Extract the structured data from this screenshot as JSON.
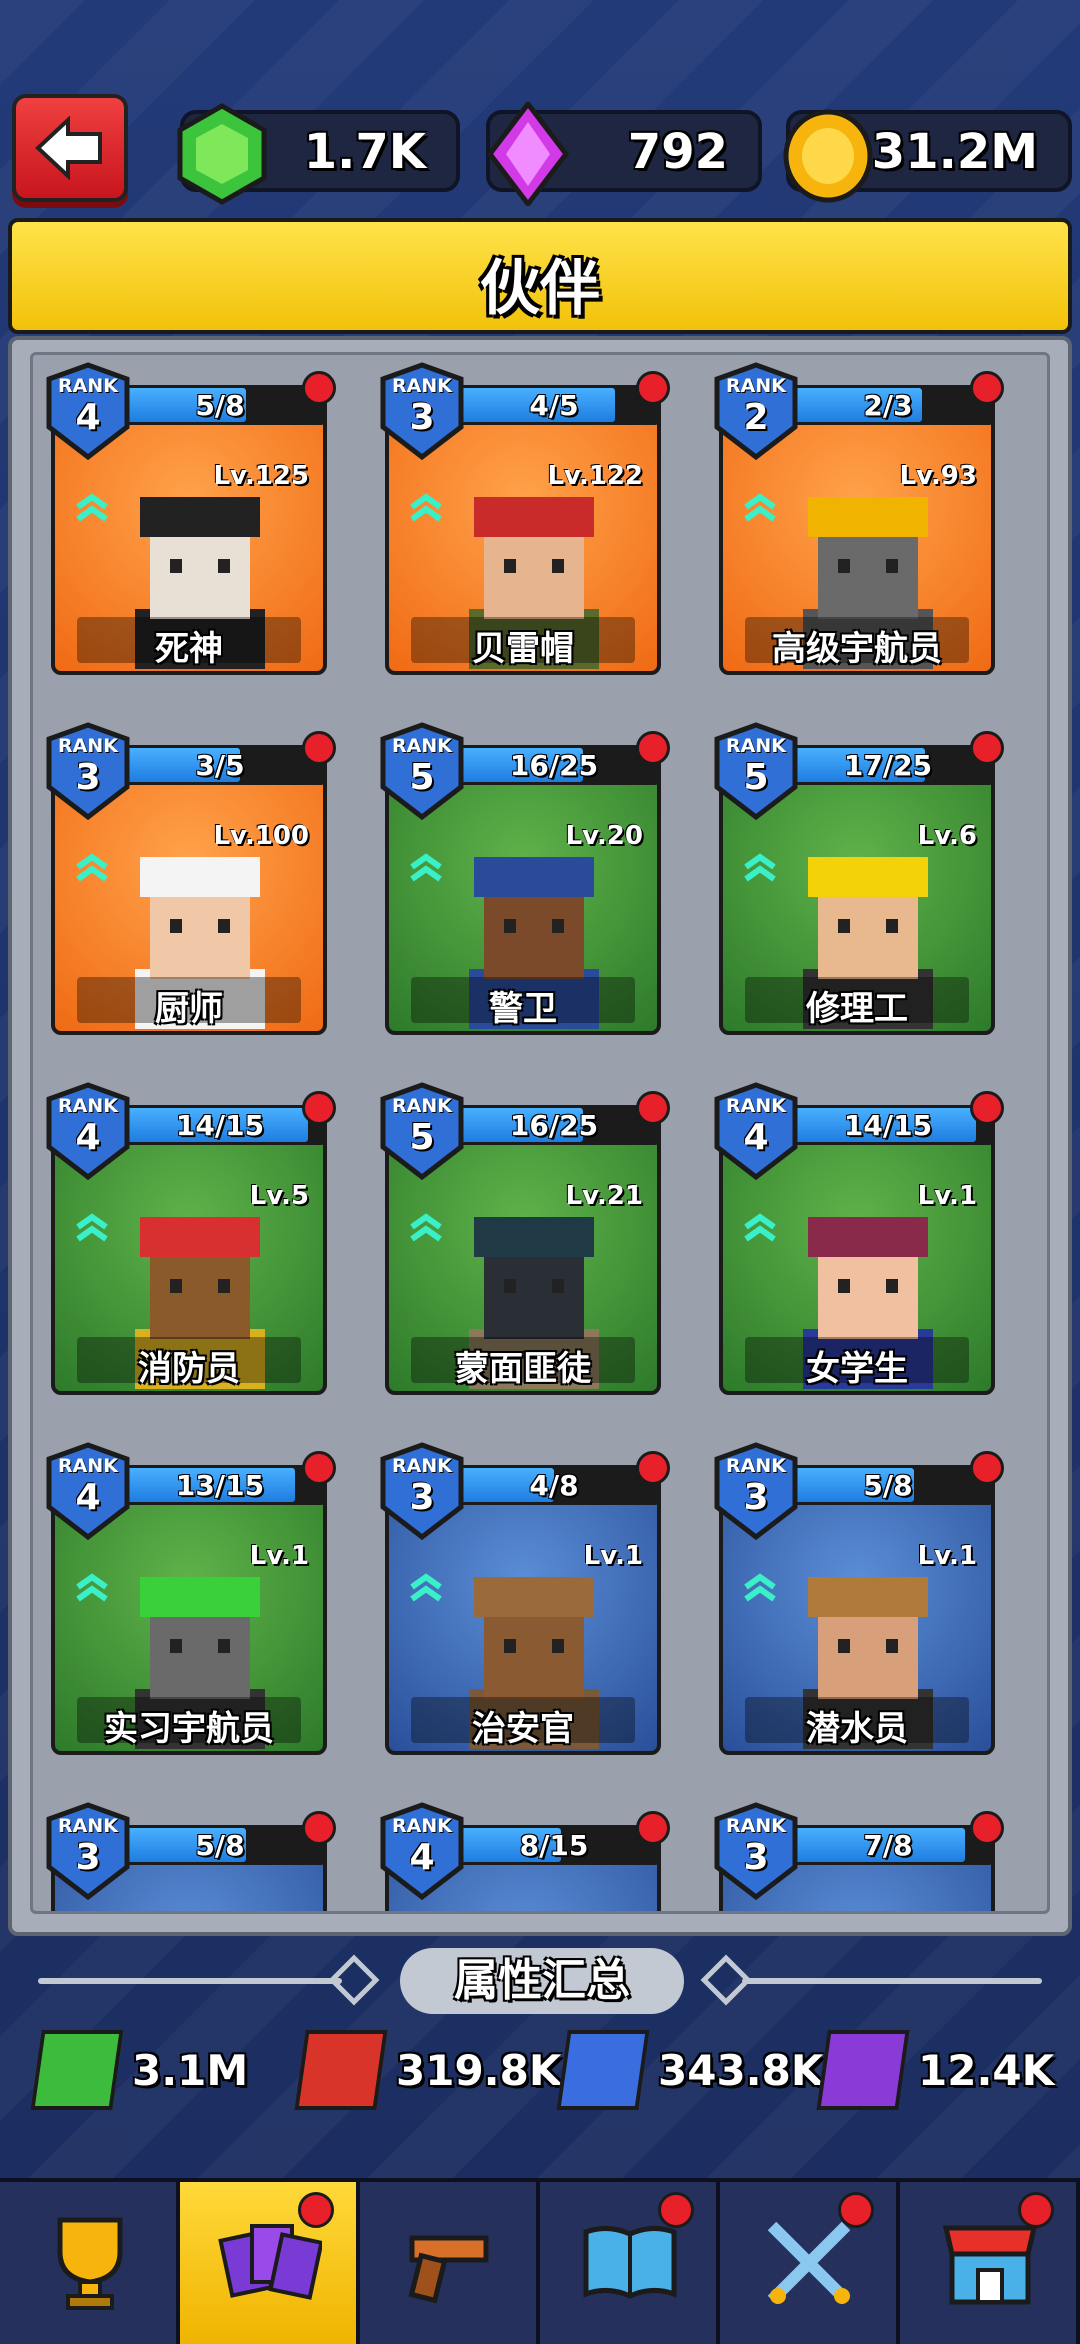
{
  "header": {
    "currencies": [
      {
        "icon": "green-gem-icon",
        "value": "1.7K"
      },
      {
        "icon": "purple-crystal-icon",
        "value": "792"
      },
      {
        "icon": "gold-coin-icon",
        "value": "31.2M"
      }
    ],
    "title": "伙伴"
  },
  "cards": [
    {
      "rank_label": "RANK",
      "rank": "4",
      "fragments": "5/8",
      "level": "Lv.125",
      "name": "死神",
      "bg": "orange",
      "fill": 0.625
    },
    {
      "rank_label": "RANK",
      "rank": "3",
      "fragments": "4/5",
      "level": "Lv.122",
      "name": "贝雷帽",
      "bg": "orange",
      "fill": 0.8
    },
    {
      "rank_label": "RANK",
      "rank": "2",
      "fragments": "2/3",
      "level": "Lv.93",
      "name": "高级宇航员",
      "bg": "orange",
      "fill": 0.667
    },
    {
      "rank_label": "RANK",
      "rank": "3",
      "fragments": "3/5",
      "level": "Lv.100",
      "name": "厨师",
      "bg": "orange",
      "fill": 0.6
    },
    {
      "rank_label": "RANK",
      "rank": "5",
      "fragments": "16/25",
      "level": "Lv.20",
      "name": "警卫",
      "bg": "green",
      "fill": 0.64
    },
    {
      "rank_label": "RANK",
      "rank": "5",
      "fragments": "17/25",
      "level": "Lv.6",
      "name": "修理工",
      "bg": "green",
      "fill": 0.68
    },
    {
      "rank_label": "RANK",
      "rank": "4",
      "fragments": "14/15",
      "level": "Lv.5",
      "name": "消防员",
      "bg": "green",
      "fill": 0.933
    },
    {
      "rank_label": "RANK",
      "rank": "5",
      "fragments": "16/25",
      "level": "Lv.21",
      "name": "蒙面匪徒",
      "bg": "green",
      "fill": 0.64
    },
    {
      "rank_label": "RANK",
      "rank": "4",
      "fragments": "14/15",
      "level": "Lv.1",
      "name": "女学生",
      "bg": "green",
      "fill": 0.933
    },
    {
      "rank_label": "RANK",
      "rank": "4",
      "fragments": "13/15",
      "level": "Lv.1",
      "name": "实习宇航员",
      "bg": "green",
      "fill": 0.867
    },
    {
      "rank_label": "RANK",
      "rank": "3",
      "fragments": "4/8",
      "level": "Lv.1",
      "name": "治安官",
      "bg": "blue",
      "fill": 0.5
    },
    {
      "rank_label": "RANK",
      "rank": "3",
      "fragments": "5/8",
      "level": "Lv.1",
      "name": "潜水员",
      "bg": "blue",
      "fill": 0.625
    },
    {
      "rank_label": "RANK",
      "rank": "3",
      "fragments": "5/8",
      "level": "",
      "name": "",
      "bg": "blue",
      "fill": 0.625
    },
    {
      "rank_label": "RANK",
      "rank": "4",
      "fragments": "8/15",
      "level": "",
      "name": "",
      "bg": "blue",
      "fill": 0.533
    },
    {
      "rank_label": "RANK",
      "rank": "3",
      "fragments": "7/8",
      "level": "",
      "name": "",
      "bg": "blue",
      "fill": 0.875
    }
  ],
  "summary": {
    "title": "属性汇总",
    "stats": [
      {
        "icon": "tower-icon",
        "value": "3.1M",
        "color": "#3dbb3d"
      },
      {
        "icon": "fist-icon",
        "value": "319.8K",
        "color": "#d9342a"
      },
      {
        "icon": "auto-gun-icon",
        "value": "343.8K",
        "color": "#3a6ee0"
      },
      {
        "icon": "money-bag-icon",
        "value": "12.4K",
        "color": "#8a3ad6"
      }
    ]
  },
  "nav": [
    {
      "icon": "trophy-icon",
      "active": false,
      "badge": false
    },
    {
      "icon": "partner-cards-icon",
      "active": true,
      "badge": true
    },
    {
      "icon": "pistol-icon",
      "active": false,
      "badge": false
    },
    {
      "icon": "book-icon",
      "active": false,
      "badge": true
    },
    {
      "icon": "crossed-swords-icon",
      "active": false,
      "badge": true
    },
    {
      "icon": "shop-icon",
      "active": false,
      "badge": true
    }
  ]
}
